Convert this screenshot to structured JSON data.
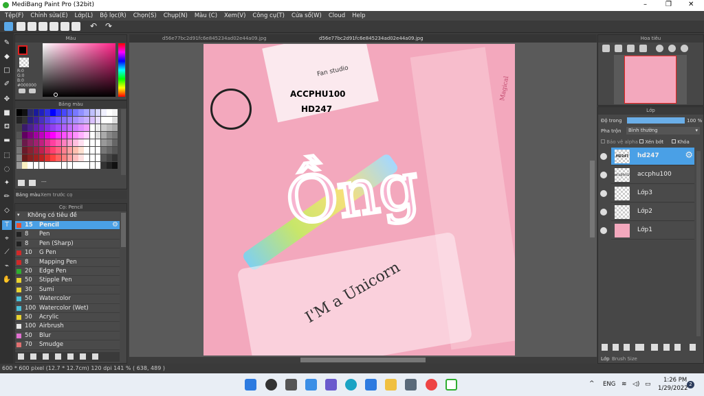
{
  "window": {
    "title": "MediBang Paint Pro (32bit)",
    "minimize": "–",
    "maximize": "❐",
    "close": "✕"
  },
  "menu": [
    "Tệp(F)",
    "Chỉnh sửa(E)",
    "Lớp(L)",
    "Bộ lọc(R)",
    "Chọn(S)",
    "Chụp(N)",
    "Màu (C)",
    "Xem(V)",
    "Công cụ(T)",
    "Cửa sổ(W)",
    "Cloud",
    "Help"
  ],
  "tabs": {
    "doc1": "d56e77bc2d91fc6e845234ad02e44a09.jpg",
    "doc2": "d56e77bc2d91fc6e845234ad02e44a09.jpg"
  },
  "color_panel": {
    "title": "Màu",
    "r": "R:0",
    "g": "G:0",
    "b": "B:0",
    "hex": "#000000"
  },
  "palette_panel": {
    "title": "Bảng màu",
    "tab1": "Bảng màu",
    "tab2": "Xem trước cọ",
    "ellipsis": "---"
  },
  "brush_panel": {
    "title": "Cọ: Pencil",
    "group": "Không có tiêu đề",
    "brushes": [
      {
        "size": "15",
        "name": "Pencil",
        "color": "#e8502f"
      },
      {
        "size": "8",
        "name": "Pen",
        "color": "#222222"
      },
      {
        "size": "8",
        "name": "Pen (Sharp)",
        "color": "#222222"
      },
      {
        "size": "10",
        "name": "G Pen",
        "color": "#d02a2a"
      },
      {
        "size": "8",
        "name": "Mapping Pen",
        "color": "#d02a2a"
      },
      {
        "size": "20",
        "name": "Edge Pen",
        "color": "#2fae2f"
      },
      {
        "size": "50",
        "name": "Stipple Pen",
        "color": "#e8d230"
      },
      {
        "size": "30",
        "name": "Sumi",
        "color": "#e8d230"
      },
      {
        "size": "50",
        "name": "Watercolor",
        "color": "#4ac0d8"
      },
      {
        "size": "100",
        "name": "Watercolor (Wet)",
        "color": "#4ac0d8"
      },
      {
        "size": "50",
        "name": "Acrylic",
        "color": "#e8d230"
      },
      {
        "size": "100",
        "name": "Airbrush",
        "color": "#e8e8e8"
      },
      {
        "size": "50",
        "name": "Blur",
        "color": "#e070d0"
      },
      {
        "size": "70",
        "name": "Smudge",
        "color": "#e07070"
      }
    ]
  },
  "navigator": {
    "title": "Hoa tiêu"
  },
  "layer_panel": {
    "title": "Lớp",
    "opacity_label": "Độ trong",
    "opacity_value": "100 %",
    "blend_label": "Pha trộn",
    "blend_value": "Bình thường",
    "protect_alpha": "Bảo vệ alpha",
    "clipping": "Xén bớt",
    "lock": "Khóa",
    "layers": [
      {
        "name": "hd247",
        "thumb_text": "HD247"
      },
      {
        "name": "accphu100",
        "thumb_text": "accphu100"
      },
      {
        "name": "Lớp3",
        "thumb_text": ""
      },
      {
        "name": "Lớp2",
        "thumb_text": ""
      },
      {
        "name": "Lớp1",
        "thumb_text": ""
      }
    ],
    "tab1": "Lớp",
    "tab2": "Brush Size"
  },
  "canvas_text": {
    "line1": "ACCPHU100",
    "line2": "HD247",
    "big": "Ồng",
    "sub": "I'M a Unicorn",
    "card": "Fan studio",
    "magical": "Magical"
  },
  "status": "600 * 600 pixel   (12.7 * 12.7cm)   120 dpi   141 %   ( 638, 489 )",
  "taskbar": {
    "lang": "ENG",
    "time": "1:26 PM",
    "date": "1/29/2022",
    "notif": "2",
    "tray_up": "^"
  },
  "colors": {
    "accent": "#4aa0e6",
    "selected_row": "#4aa0e6",
    "canvas_pink": "#f3a8bd"
  }
}
